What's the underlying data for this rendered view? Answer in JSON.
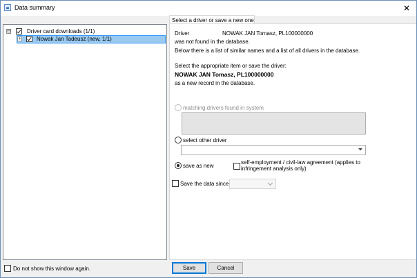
{
  "window": {
    "title": "Data summary",
    "close_glyph": "✕"
  },
  "tree": {
    "root": {
      "label": "Driver card downloads (1/1)",
      "expander": "⊟",
      "checked": true
    },
    "child": {
      "label": "Nowak Jan Tadeusz  (new, 1/1)",
      "expander": "+",
      "checked": true,
      "selected": true
    }
  },
  "tab": {
    "label": "Select a driver or save a new one"
  },
  "driver_info": {
    "driver_label": "Driver",
    "driver_name": "NOWAK JAN Tomasz, PL100000000",
    "not_found": "was not found in the database.",
    "below_text": "Below there is a list of similar names and a list of all drivers in the database.",
    "select_prompt": "Select the appropriate item or save the driver:",
    "bold_name": "NOWAK JAN Tomasz, PL100000000",
    "as_new": "as a new record in the database."
  },
  "options": {
    "matching_label": "matching drivers found in system",
    "other_label": "select other driver",
    "other_value": "",
    "save_new_label": "save as new",
    "selected": "save as new",
    "self_employment_line1": "self-employment / civil-law agreement (applies to",
    "self_employment_line2": "infringement analysis only)",
    "self_employment_checked": false,
    "save_since_label": "Save the data since",
    "save_since_checked": false,
    "save_since_value": ""
  },
  "footer": {
    "dont_show_label": "Do not show this window again.",
    "dont_show_checked": false,
    "save_label": "Save",
    "cancel_label": "Cancel"
  },
  "colors": {
    "selection": "#99c9ef",
    "accent": "#0078d7",
    "disabled_text": "#8c8c8c"
  },
  "icons": {
    "window": "window-icon",
    "close": "close-icon",
    "combo": "chevron-down-icon"
  }
}
